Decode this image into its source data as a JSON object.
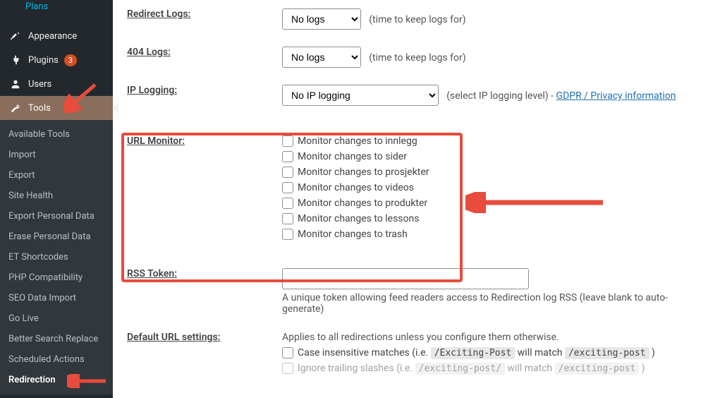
{
  "sidebar": {
    "top_item": "Plans",
    "main": [
      {
        "icon": "brush",
        "label": "Appearance"
      },
      {
        "icon": "plug",
        "label": "Plugins",
        "badge": "3"
      },
      {
        "icon": "users",
        "label": "Users"
      },
      {
        "icon": "wrench",
        "label": "Tools",
        "active": true
      }
    ],
    "sub": [
      "Available Tools",
      "Import",
      "Export",
      "Site Health",
      "Export Personal Data",
      "Erase Personal Data",
      "ET Shortcodes",
      "PHP Compatibility",
      "SEO Data Import",
      "Go Live",
      "Better Search Replace",
      "Scheduled Actions",
      "Redirection"
    ],
    "current_sub": "Redirection"
  },
  "labels": {
    "redirect_logs": "Redirect Logs:",
    "404_logs": "404 Logs:",
    "ip_logging": "IP Logging:",
    "url_monitor": "URL Monitor:",
    "rss_token": "RSS Token:",
    "default_url": "Default URL settings:"
  },
  "selects": {
    "no_logs": "No logs",
    "no_ip": "No IP logging"
  },
  "hints": {
    "time": "(time to keep logs for)",
    "ip_level": "(select IP logging level) - ",
    "gdpr": "GDPR / Privacy information",
    "rss_desc": "A unique token allowing feed readers access to Redirection log RSS (leave blank to auto-generate)",
    "default_desc": "Applies to all redirections unless you configure them otherwise."
  },
  "monitors": [
    "Monitor changes to innlegg",
    "Monitor changes to sider",
    "Monitor changes to prosjekter",
    "Monitor changes to videos",
    "Monitor changes to produkter",
    "Monitor changes to lessons",
    "Monitor changes to trash"
  ],
  "url_settings": {
    "case": "Case insensitive matches (i.e.",
    "code1": "/Exciting-Post",
    "will_match": "will match",
    "code2": "/exciting-post",
    "paren": ")",
    "ignore": "Ignore trailing slashes (i.e.",
    "code3": "/exciting-post/",
    "code4": "/exciting-post"
  }
}
